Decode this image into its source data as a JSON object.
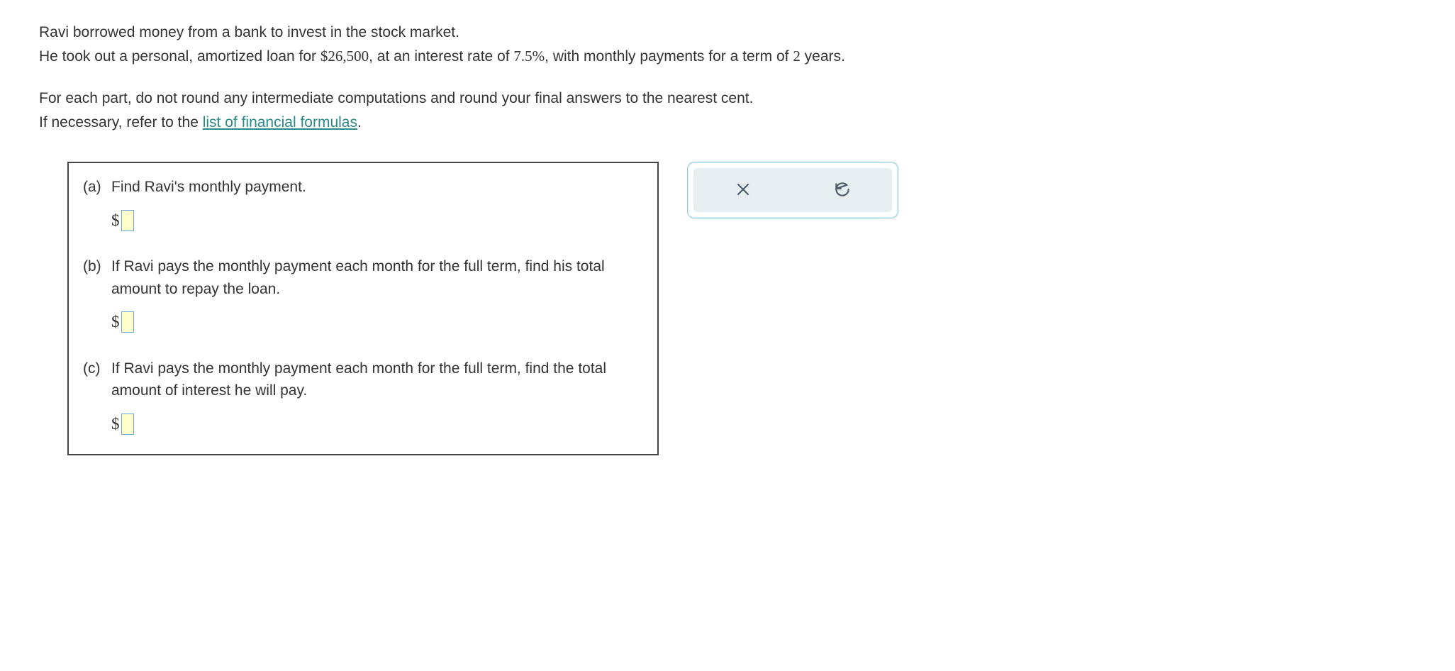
{
  "intro": {
    "line1": "Ravi borrowed money from a bank to invest in the stock market.",
    "line2_a": "He took out a personal, amortized loan for ",
    "amount": "$26,500",
    "line2_b": ", at an interest rate of ",
    "rate": "7.5%",
    "line2_c": ", with monthly payments for a term of ",
    "term": "2",
    "line2_d": " years."
  },
  "instructions": {
    "line1": "For each part, do not round any intermediate computations and round your final answers to the nearest cent.",
    "line2_a": "If necessary, refer to the ",
    "link": "list of financial formulas",
    "line2_b": "."
  },
  "parts": {
    "a": {
      "label": "(a)",
      "text": "Find Ravi's monthly payment.",
      "prefix": "$"
    },
    "b": {
      "label": "(b)",
      "text": "If Ravi pays the monthly payment each month for the full term, find his total amount to repay the loan.",
      "prefix": "$"
    },
    "c": {
      "label": "(c)",
      "text": "If Ravi pays the monthly payment each month for the full term, find the total amount of interest he will pay.",
      "prefix": "$"
    }
  },
  "controls": {
    "clear": "clear",
    "reset": "reset"
  }
}
